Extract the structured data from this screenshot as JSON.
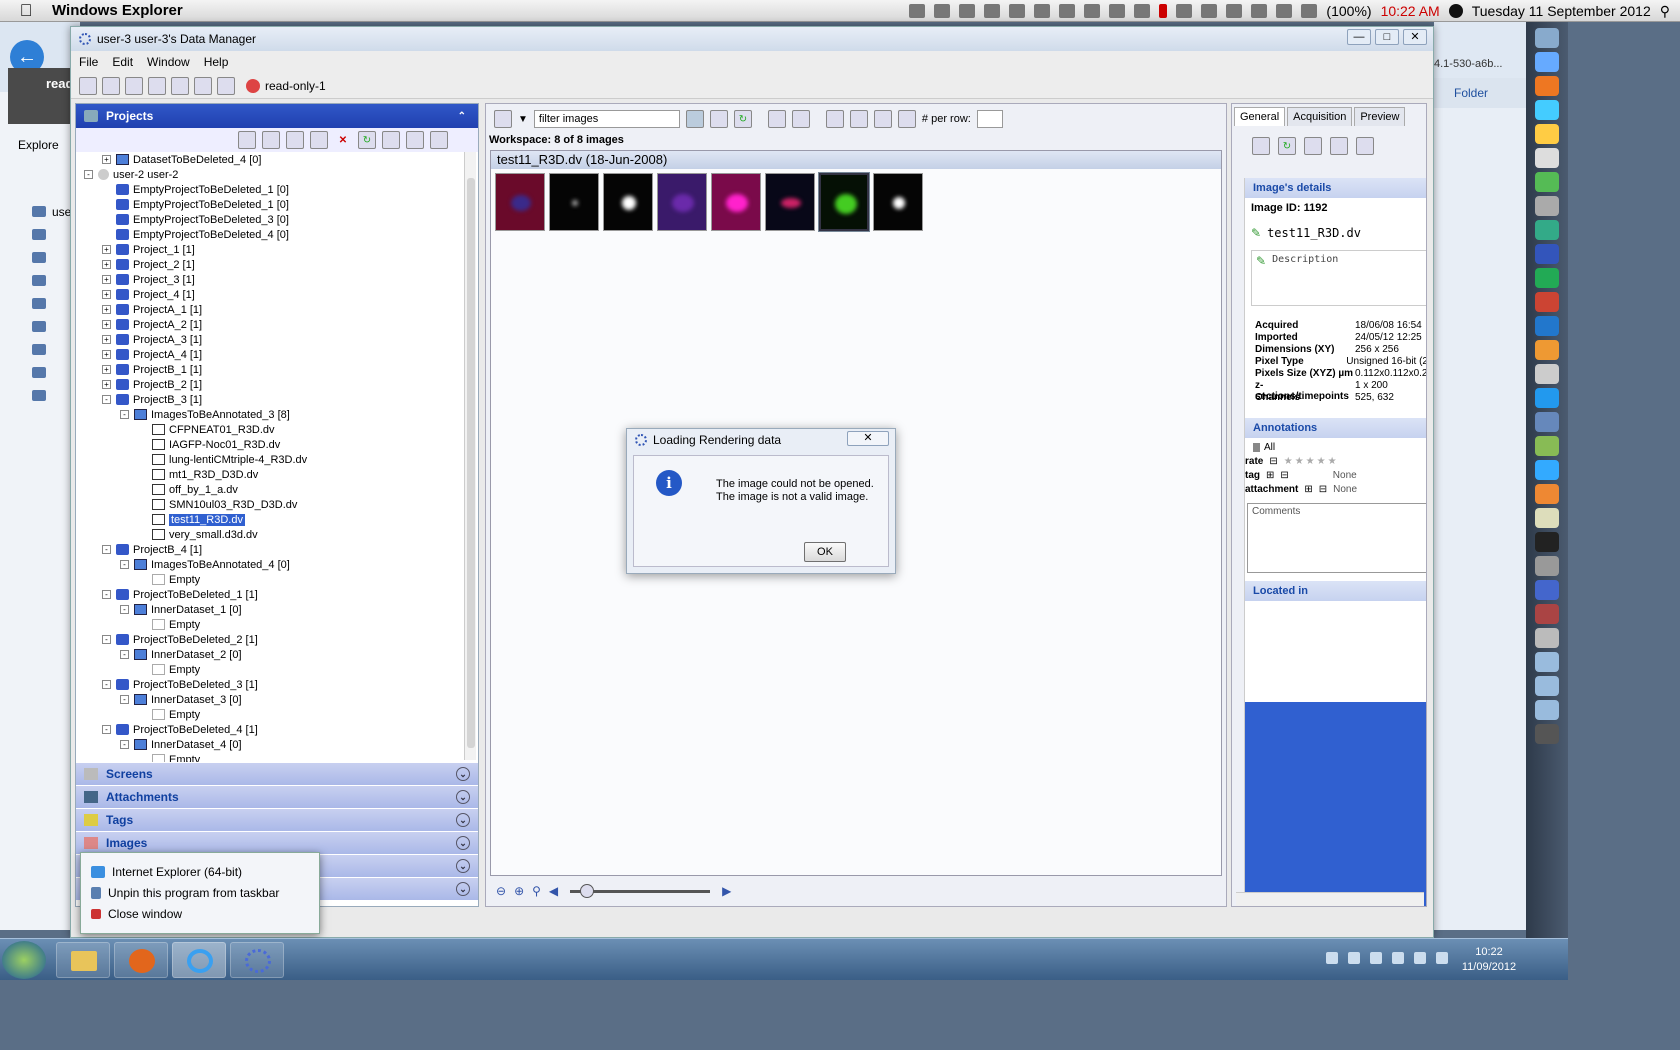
{
  "mac_menubar": {
    "app_name": "Windows Explorer",
    "battery": "(100%)",
    "time": "10:22 AM",
    "date": "Tuesday 11 September 2012"
  },
  "background_explorer": {
    "tab_label": "read",
    "explore_label": "Explore",
    "tree_first": "user",
    "search_text": "4.1-530-a6b...",
    "folder_label": "Folder"
  },
  "window": {
    "title": "user-3 user-3's Data Manager",
    "menu": [
      "File",
      "Edit",
      "Window",
      "Help"
    ],
    "group_label": "read-only-1"
  },
  "left_panel": {
    "header": "Projects",
    "tree": [
      {
        "level": 2,
        "type": "ds",
        "exp": "+",
        "label": "DatasetToBeDeleted_4 [0]"
      },
      {
        "level": 1,
        "type": "usr",
        "exp": "-",
        "label": "user-2 user-2"
      },
      {
        "level": 2,
        "type": "proj",
        "exp": "",
        "label": "EmptyProjectToBeDeleted_1 [0]"
      },
      {
        "level": 2,
        "type": "proj",
        "exp": "",
        "label": "EmptyProjectToBeDeleted_1 [0]"
      },
      {
        "level": 2,
        "type": "proj",
        "exp": "",
        "label": "EmptyProjectToBeDeleted_3 [0]"
      },
      {
        "level": 2,
        "type": "proj",
        "exp": "",
        "label": "EmptyProjectToBeDeleted_4 [0]"
      },
      {
        "level": 2,
        "type": "proj",
        "exp": "+",
        "label": "Project_1 [1]"
      },
      {
        "level": 2,
        "type": "proj",
        "exp": "+",
        "label": "Project_2 [1]"
      },
      {
        "level": 2,
        "type": "proj",
        "exp": "+",
        "label": "Project_3 [1]"
      },
      {
        "level": 2,
        "type": "proj",
        "exp": "+",
        "label": "Project_4 [1]"
      },
      {
        "level": 2,
        "type": "proj",
        "exp": "+",
        "label": "ProjectA_1 [1]"
      },
      {
        "level": 2,
        "type": "proj",
        "exp": "+",
        "label": "ProjectA_2 [1]"
      },
      {
        "level": 2,
        "type": "proj",
        "exp": "+",
        "label": "ProjectA_3 [1]"
      },
      {
        "level": 2,
        "type": "proj",
        "exp": "+",
        "label": "ProjectA_4 [1]"
      },
      {
        "level": 2,
        "type": "proj",
        "exp": "+",
        "label": "ProjectB_1 [1]"
      },
      {
        "level": 2,
        "type": "proj",
        "exp": "+",
        "label": "ProjectB_2 [1]"
      },
      {
        "level": 2,
        "type": "proj",
        "exp": "-",
        "label": "ProjectB_3 [1]"
      },
      {
        "level": 3,
        "type": "ds",
        "exp": "-",
        "label": "ImagesToBeAnnotated_3 [8]"
      },
      {
        "level": 4,
        "type": "img",
        "exp": "",
        "label": "CFPNEAT01_R3D.dv"
      },
      {
        "level": 4,
        "type": "img",
        "exp": "",
        "label": "IAGFP-Noc01_R3D.dv"
      },
      {
        "level": 4,
        "type": "img",
        "exp": "",
        "label": "lung-lentiCMtriple-4_R3D.dv"
      },
      {
        "level": 4,
        "type": "img",
        "exp": "",
        "label": "mt1_R3D_D3D.dv"
      },
      {
        "level": 4,
        "type": "img",
        "exp": "",
        "label": "off_by_1_a.dv"
      },
      {
        "level": 4,
        "type": "img",
        "exp": "",
        "label": "SMN10ul03_R3D_D3D.dv"
      },
      {
        "level": 4,
        "type": "img",
        "exp": "",
        "label": "test11_R3D.dv",
        "selected": true
      },
      {
        "level": 4,
        "type": "img",
        "exp": "",
        "label": "very_small.d3d.dv"
      },
      {
        "level": 2,
        "type": "proj",
        "exp": "-",
        "label": "ProjectB_4 [1]"
      },
      {
        "level": 3,
        "type": "ds",
        "exp": "-",
        "label": "ImagesToBeAnnotated_4 [0]"
      },
      {
        "level": 4,
        "type": "empty",
        "exp": "",
        "label": "Empty"
      },
      {
        "level": 2,
        "type": "proj",
        "exp": "-",
        "label": "ProjectToBeDeleted_1 [1]"
      },
      {
        "level": 3,
        "type": "ds",
        "exp": "-",
        "label": "InnerDataset_1 [0]"
      },
      {
        "level": 4,
        "type": "empty",
        "exp": "",
        "label": "Empty"
      },
      {
        "level": 2,
        "type": "proj",
        "exp": "-",
        "label": "ProjectToBeDeleted_2 [1]"
      },
      {
        "level": 3,
        "type": "ds",
        "exp": "-",
        "label": "InnerDataset_2 [0]"
      },
      {
        "level": 4,
        "type": "empty",
        "exp": "",
        "label": "Empty"
      },
      {
        "level": 2,
        "type": "proj",
        "exp": "-",
        "label": "ProjectToBeDeleted_3 [1]"
      },
      {
        "level": 3,
        "type": "ds",
        "exp": "-",
        "label": "InnerDataset_3 [0]"
      },
      {
        "level": 4,
        "type": "empty",
        "exp": "",
        "label": "Empty"
      },
      {
        "level": 2,
        "type": "proj",
        "exp": "-",
        "label": "ProjectToBeDeleted_4 [1]"
      },
      {
        "level": 3,
        "type": "ds",
        "exp": "-",
        "label": "InnerDataset_4 [0]"
      },
      {
        "level": 4,
        "type": "empty",
        "exp": "",
        "label": "Empty"
      }
    ],
    "accordions": [
      "Screens",
      "Attachments",
      "Tags",
      "Images"
    ]
  },
  "center_panel": {
    "filter_placeholder": "filter  images",
    "per_row_label": "# per row:",
    "workspace_label": "Workspace: 8 of 8 images",
    "dataset_title": "test11_R3D.dv (18-Jun-2008)",
    "thumbnails": [
      {
        "bg": "#6a0a2a",
        "blob": "#3a2a8a"
      },
      {
        "bg": "#050505",
        "blob": "#aaaaaa"
      },
      {
        "bg": "#050505",
        "blob": "#ffffff"
      },
      {
        "bg": "#3a1a6a",
        "blob": "#6a2aaa"
      },
      {
        "bg": "#7a0a4a",
        "blob": "#ff22cc"
      },
      {
        "bg": "#080818",
        "blob": "#cc2266"
      },
      {
        "bg": "#051005",
        "blob": "#44cc22",
        "selected": true
      },
      {
        "bg": "#050505",
        "blob": "#ffffff"
      }
    ]
  },
  "right_panel": {
    "tabs": [
      "General",
      "Acquisition",
      "Preview"
    ],
    "details_header": "Image's details",
    "image_id": "Image ID: 1192",
    "image_name": "test11_R3D.dv",
    "description": "Description",
    "metadata": [
      {
        "k": "Acquired",
        "v": "18/06/08 16:54"
      },
      {
        "k": "Imported",
        "v": "24/05/12 12:25"
      },
      {
        "k": "Dimensions (XY)",
        "v": "256 x 256"
      },
      {
        "k": "Pixel Type",
        "v": "Unsigned 16-bit (2"
      },
      {
        "k": "Pixels Size (XYZ) µm",
        "v": "0.112x0.112x0.2"
      },
      {
        "k": "z-sections/timepoints",
        "v": "1 x 200"
      },
      {
        "k": "Channels",
        "v": "525, 632"
      }
    ],
    "annotations_header": "Annotations",
    "all_label": "All",
    "rate_label": "rate",
    "tag_label": "tag",
    "tag_value": "None",
    "attachment_label": "attachment",
    "attachment_value": "None",
    "comments_placeholder": "Comments",
    "located_in": "Located in"
  },
  "dialog": {
    "title": "Loading Rendering data",
    "line1": "The image could not be opened.",
    "line2": "The image is not a valid image.",
    "ok": "OK"
  },
  "jump_list": {
    "items": [
      "Internet Explorer (64-bit)",
      "Unpin this program from taskbar",
      "Close window"
    ]
  },
  "taskbar": {
    "time": "10:22",
    "date": "11/09/2012"
  }
}
